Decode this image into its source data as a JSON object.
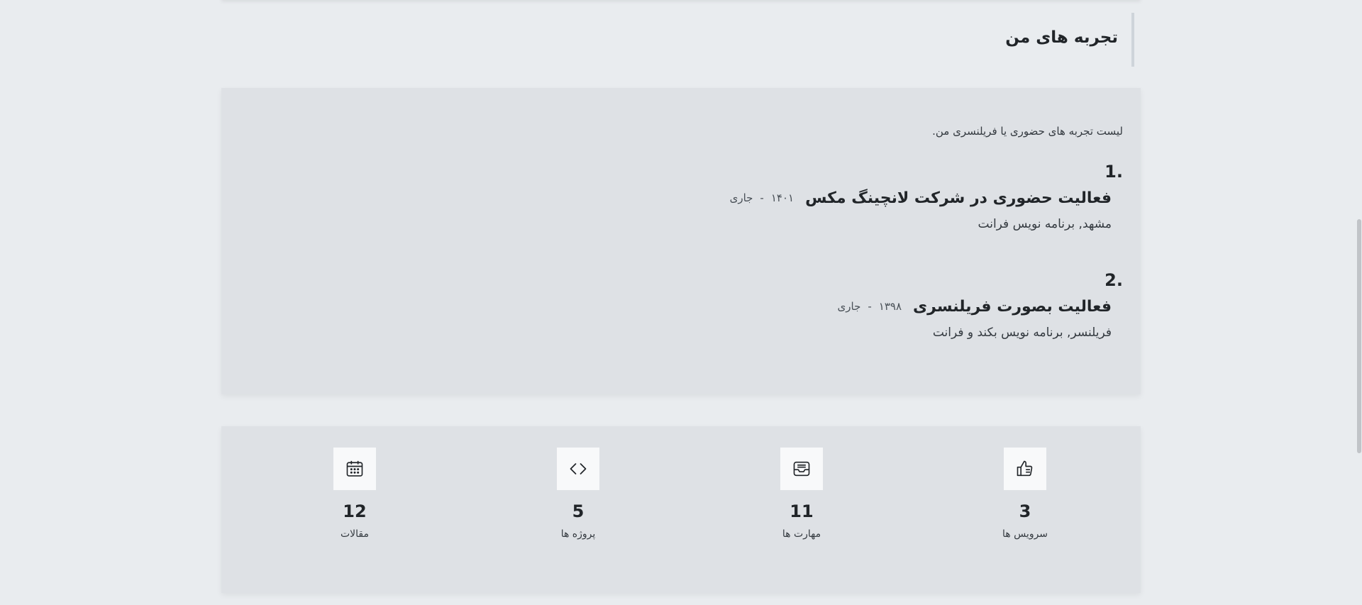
{
  "experience_section": {
    "title": "تجربه های من",
    "intro": "لیست تجربه های حضوری یا فریلنسری من.",
    "items": [
      {
        "number": "1.",
        "title": "فعالیت حضوری در شرکت لانچینگ مکس",
        "start": "۱۴۰۱",
        "separator": "-",
        "end": "جاری",
        "description": "مشهد, برنامه نویس فرانت"
      },
      {
        "number": "2.",
        "title": "فعالیت بصورت فریلنسری",
        "start": "۱۳۹۸",
        "separator": "-",
        "end": "جاری",
        "description": "فریلنسر, برنامه نویس بکند و فرانت"
      }
    ]
  },
  "stats": [
    {
      "icon": "thumbs-up-icon",
      "count": "3",
      "label": "سرویس ها"
    },
    {
      "icon": "inbox-icon",
      "count": "11",
      "label": "مهارت ها"
    },
    {
      "icon": "code-icon",
      "count": "5",
      "label": "پروژه ها"
    },
    {
      "icon": "calendar-icon",
      "count": "12",
      "label": "مقالات"
    }
  ]
}
